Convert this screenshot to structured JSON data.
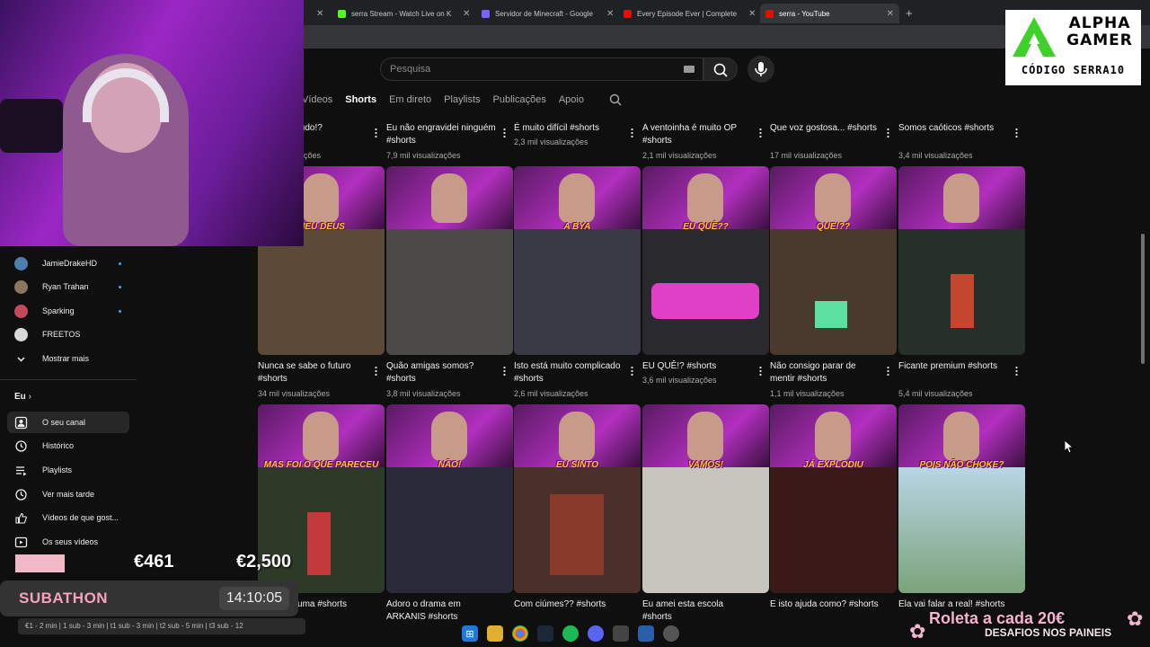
{
  "browser": {
    "tabs": [
      {
        "title": "serra Stream - Watch Live on K",
        "icon": "kick-icon",
        "color": "#53fc18"
      },
      {
        "title": "Servidor de Minecraft - Google",
        "icon": "docs-icon",
        "color": "#7b61ff"
      },
      {
        "title": "Every Episode Ever | Complete",
        "icon": "youtube-icon",
        "color": "#ff0000"
      },
      {
        "title": "serra - YouTube",
        "icon": "youtube-icon",
        "color": "#ff0000"
      }
    ]
  },
  "youtube": {
    "search_placeholder": "Pesquisa",
    "channel_tabs": [
      "Vídeos",
      "Shorts",
      "Em direto",
      "Playlists",
      "Publicações",
      "Apoio"
    ],
    "active_tab": "Shorts"
  },
  "sidebar": {
    "subscriptions": [
      {
        "name": "JamieDrakeHD",
        "color": "#4a7fb0"
      },
      {
        "name": "Ryan Trahan",
        "color": "#8a7560"
      },
      {
        "name": "Sparking",
        "color": "#c24a5a"
      },
      {
        "name": "FREETOS",
        "color": "#d8d8d8"
      }
    ],
    "show_more": "Mostrar mais",
    "section_title": "Eu",
    "nav": [
      {
        "label": "O seu canal",
        "icon": "channel-icon"
      },
      {
        "label": "Histórico",
        "icon": "history-icon"
      },
      {
        "label": "Playlists",
        "icon": "playlists-icon"
      },
      {
        "label": "Ver mais tarde",
        "icon": "clock-icon"
      },
      {
        "label": "Vídeos de que gost...",
        "icon": "like-icon"
      },
      {
        "label": "Os seus vídeos",
        "icon": "your-videos-icon"
      }
    ]
  },
  "shorts": {
    "row0": [
      {
        "title": "tudo!?",
        "views": "...lizações"
      },
      {
        "title": "Eu não engravidei ninguém #shorts",
        "views": "7,9 mil visualizações"
      },
      {
        "title": "É muito difícil #shorts",
        "views": "2,3 mil visualizações"
      },
      {
        "title": "A ventoinha é muito OP #shorts",
        "views": "2,1 mil visualizações"
      },
      {
        "title": "Que voz gostosa... #shorts",
        "views": "17 mil visualizações"
      },
      {
        "title": "Somos caóticos #shorts",
        "views": "3,4 mil visualizações"
      }
    ],
    "row1": [
      {
        "caption": "MEU DEUS",
        "title": "Nunca se sabe o futuro #shorts",
        "views": "34 mil visualizações",
        "bg": "#5b4a38"
      },
      {
        "caption": "",
        "title": "Quão amigas somos? #shorts",
        "views": "3,8 mil visualizações",
        "bg": "#4c4a48"
      },
      {
        "caption": "A BYA",
        "title": "Isto está muito complicado #shorts",
        "views": "2,6 mil visualizações",
        "bg": "#3a3a46"
      },
      {
        "caption": "EU QUÊ??",
        "title": "EU QUÊ!? #shorts",
        "views": "3,6 mil visualizações",
        "bg": "#2a2a2e"
      },
      {
        "caption": "QUE!??",
        "title": "Não consigo parar de mentir #shorts",
        "views": "1,1 mil visualizações",
        "bg": "#4a3a2e"
      },
      {
        "caption": "",
        "title": "Ficante premium #shorts",
        "views": "5,4 mil visualizações",
        "bg": "#25302a"
      }
    ],
    "row2": [
      {
        "caption": "MAS FOI O QUE PARECEU",
        "title": "...er uma #shorts",
        "views": "",
        "bg": "#2e3a28"
      },
      {
        "caption": "NÃO!",
        "title": "Adoro o drama em ARKANIS #shorts",
        "views": "",
        "bg": "#2a2a3a"
      },
      {
        "caption": "EU SINTO",
        "title": "Com ciúmes?? #shorts",
        "views": "",
        "bg": "#4a3028"
      },
      {
        "caption": "VAMOS!",
        "title": "Eu amei esta escola #shorts",
        "views": "",
        "bg": "#c8c4be"
      },
      {
        "caption": "JÁ EXPLODIU",
        "title": "E isto ajuda como? #shorts",
        "views": "",
        "bg": "#3a1a18"
      },
      {
        "caption": "POIS NÃO CHOKE?",
        "title": "Ela vai falar a real! #shorts",
        "views": "",
        "bg": "#7aa37a"
      }
    ]
  },
  "overlay": {
    "sponsor_name": "ALPHA GAMER",
    "sponsor_code": "CÓDIGO SERRA10",
    "goal_left": "€461",
    "goal_right": "€2,500",
    "subathon_title": "SUBATHON",
    "subathon_timer": "14:10:05",
    "ticker": "€1 - 2 min | 1 sub - 3 min | t1 sub - 3 min | t2 sub - 5 min | t3 sub - 12",
    "roleta": "Roleta a cada 20€",
    "desafios": "DESAFIOS NOS PAINEIS"
  },
  "colors": {
    "background": "#0f0f0f",
    "accent_pink": "#f3a3bd",
    "caption_yellow": "#f6d000"
  }
}
